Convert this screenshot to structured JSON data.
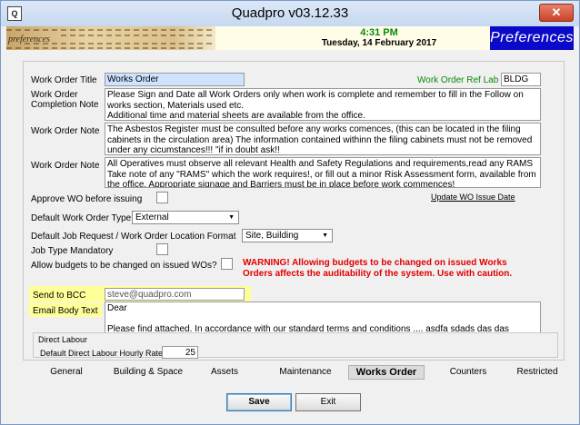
{
  "window": {
    "title": "Quadpro v03.12.33",
    "close_label": "✕",
    "app_icon_label": "Q"
  },
  "banner": {
    "time": "4:31 PM",
    "date": "Tuesday, 14 February 2017",
    "section_badge": "Preferences",
    "parchment_word": "preferences",
    "colors": {
      "time": "#0a8a0a",
      "badge_bg": "#0a0ac8"
    }
  },
  "form": {
    "work_order_title_label": "Work Order Title",
    "work_order_title_value": "Works Order",
    "ref_lab_label": "Work Order Ref Lab",
    "ref_lab_value": "BLDG",
    "completion_note_label": "Work Order Completion Note",
    "completion_note_lines": [
      "Please Sign and Date all Work Orders only when work is complete and remember to fill in the Follow on works section, Materials used etc.",
      "Additional time and material sheets are available from the office."
    ],
    "note1_label": "Work Order Note",
    "note1_text": "The Asbestos Register must be consulted before any works comences, (this can be located in the filing cabinets in the circulation area) The information contained withinn the filing cabinets must not be removed under any cicumstances!!! \"if in doubt ask!!",
    "note2_label": "Work Order Note",
    "note2_text": "All Operatives must observe all relevant Health and Safety Regulations and requirements,read any  RAMS Take note of any \"RAMS\" which the work requires!, or fill out a minor Risk Assessment form, available from the office. Appropriate signage and Barriers must be in place before work commences!",
    "approve_label": "Approve WO before issuing",
    "update_link": "Update WO Issue Date",
    "default_type_label": "Default Work Order Type",
    "default_type_value": "External",
    "location_format_label": "Default Job Request / Work Order Location Format",
    "location_format_value": "Site, Building",
    "job_type_label": "Job Type Mandatory",
    "budgets_label": "Allow budgets to be changed on issued WOs?",
    "budget_warning": "WARNING! Allowing budgets to be changed on issued Works Orders affects the auditability of the system. Use with caution.",
    "send_bcc_label": "Send to BCC",
    "send_bcc_value": "steve@quadpro.com",
    "email_body_label": "Email Body Text",
    "email_body_lines": [
      "Dear",
      "Please find attached. In accordance with our standard terms and conditions .... asdfa sdads das das"
    ],
    "direct_labour_group": "Direct Labour",
    "hourly_rate_label": "Default Direct Labour Hourly Rate",
    "hourly_rate_value": "25"
  },
  "tabs": [
    {
      "label": "General",
      "active": false
    },
    {
      "label": "Building & Space",
      "active": false
    },
    {
      "label": "Assets",
      "active": false
    },
    {
      "label": "Maintenance",
      "active": false
    },
    {
      "label": "Works Order",
      "active": true
    },
    {
      "label": "Counters",
      "active": false
    },
    {
      "label": "Restricted",
      "active": false
    }
  ],
  "buttons": {
    "save_label": "Save",
    "exit_label": "Exit"
  }
}
